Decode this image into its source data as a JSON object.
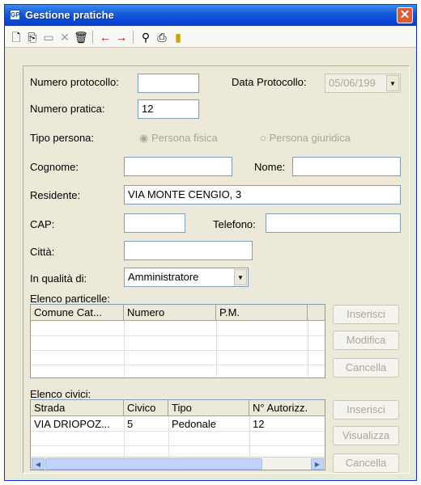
{
  "window": {
    "title": "Gestione pratiche",
    "icon_label": "GP"
  },
  "toolbar": {
    "icons": [
      "new-icon",
      "copy-icon",
      "save-icon",
      "cancel-icon",
      "delete-icon",
      "prev-icon",
      "next-icon",
      "find-icon",
      "print-icon",
      "exit-icon"
    ]
  },
  "form": {
    "numero_protocollo": {
      "label": "Numero protocollo:",
      "value": ""
    },
    "data_protocollo": {
      "label": "Data Protocollo:",
      "value": "05/06/199"
    },
    "numero_pratica": {
      "label": "Numero pratica:",
      "value": "12"
    },
    "tipo_persona": {
      "label": "Tipo persona:",
      "option_fisica": "Persona fisica",
      "option_giuridica": "Persona giuridica",
      "selected": "Persona fisica"
    },
    "cognome": {
      "label": "Cognome:",
      "value": ""
    },
    "nome": {
      "label": "Nome:",
      "value": ""
    },
    "residente": {
      "label": "Residente:",
      "value": "VIA MONTE CENGIO, 3"
    },
    "cap": {
      "label": "CAP:",
      "value": ""
    },
    "telefono": {
      "label": "Telefono:",
      "value": ""
    },
    "citta": {
      "label": "Città:",
      "value": ""
    },
    "qualita": {
      "label": "In qualità di:",
      "value": "Amministratore"
    }
  },
  "particelle": {
    "label": "Elenco particelle:",
    "columns": [
      "Comune Cat...",
      "Numero",
      "P.M."
    ],
    "rows": [],
    "buttons": {
      "inserisci": "Inserisci",
      "modifica": "Modifica",
      "cancella": "Cancella"
    }
  },
  "civici": {
    "label": "Elenco civici:",
    "columns": [
      "Strada",
      "Civico",
      "Tipo",
      "N° Autorizz."
    ],
    "rows": [
      {
        "strada": "VIA DRIOPOZ...",
        "civico": "5",
        "tipo": "Pedonale",
        "autorizz": "12"
      }
    ],
    "buttons": {
      "inserisci": "Inserisci",
      "visualizza": "Visualizza",
      "cancella": "Cancella"
    }
  },
  "colors": {
    "titlebar": "#0a46d8",
    "window_bg": "#ece9d8",
    "close": "#e35a36",
    "disabled_text": "#aca899",
    "field_border": "#7f9db9"
  }
}
